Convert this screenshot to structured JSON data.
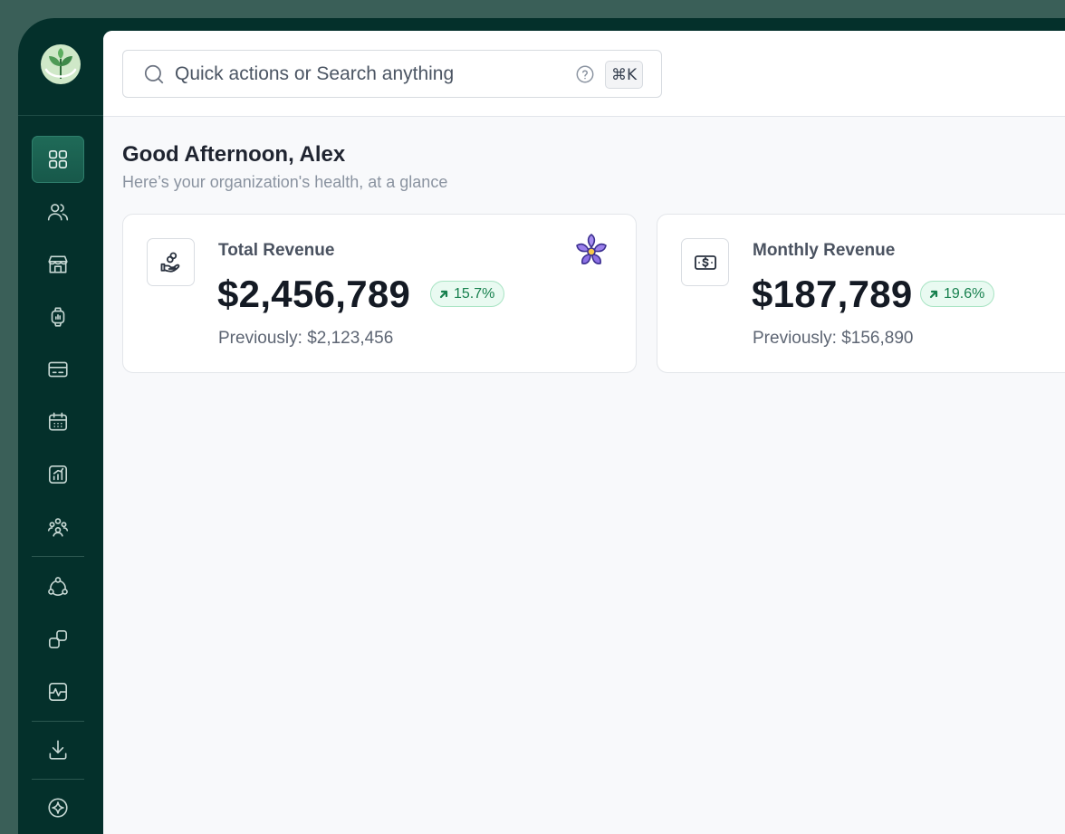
{
  "search": {
    "placeholder": "Quick actions or Search anything",
    "shortcut": "⌘K"
  },
  "nav": {
    "items": [
      {
        "name": "dashboard",
        "icon": "grid-icon",
        "active": true
      },
      {
        "name": "users",
        "icon": "users-icon"
      },
      {
        "name": "store",
        "icon": "store-icon"
      },
      {
        "name": "watch",
        "icon": "smartwatch-icon"
      },
      {
        "name": "billing",
        "icon": "credit-card-icon"
      },
      {
        "name": "calendar",
        "icon": "calendar-icon"
      },
      {
        "name": "analytics",
        "icon": "chart-icon"
      },
      {
        "name": "team",
        "icon": "team-icon"
      },
      {
        "name": "integrations",
        "icon": "connections-icon"
      },
      {
        "name": "apps",
        "icon": "shapes-icon"
      },
      {
        "name": "activity",
        "icon": "pulse-icon"
      },
      {
        "name": "download",
        "icon": "download-icon"
      },
      {
        "name": "ai",
        "icon": "sparkle-icon"
      }
    ]
  },
  "greeting": {
    "title": "Good Afternoon, Alex",
    "subtitle": "Here’s your organization's health, at a glance"
  },
  "cards": [
    {
      "title": "Total Revenue",
      "value": "$2,456,789",
      "change": "15.7%",
      "previous": "Previously: $2,123,456",
      "icon": "hand-coins-icon"
    },
    {
      "title": "Monthly Revenue",
      "value": "$187,789",
      "change": "19.6%",
      "previous": "Previously: $156,890",
      "icon": "banknote-icon"
    }
  ],
  "colors": {
    "sidebar": "#04302b",
    "accent": "#17584a",
    "positive": "#17804e"
  }
}
